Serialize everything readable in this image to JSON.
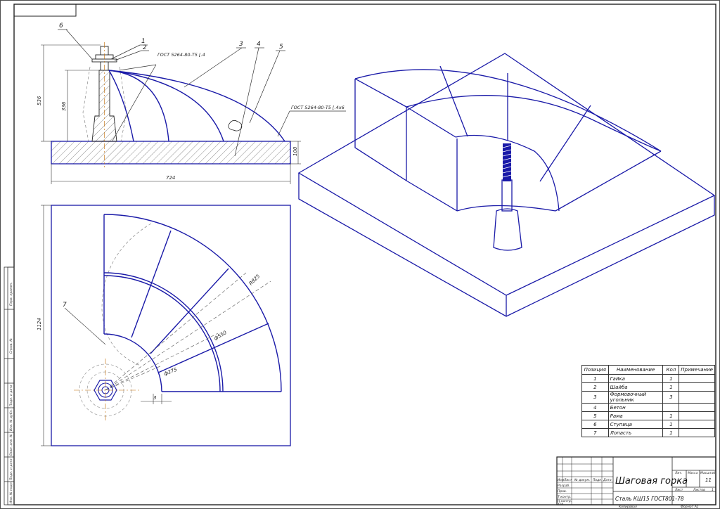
{
  "colors": {
    "line": "#1a1aa8",
    "thin": "#333333",
    "paper": "#ffffff"
  },
  "front_view": {
    "part_labels": [
      "1",
      "2",
      "3",
      "4",
      "5",
      "6"
    ],
    "weld_note_top": "ГОСТ 5264-80-Т5 ⌊.4",
    "weld_note_right": "ГОСТ 5264-80-Т5 ⌊.4х6",
    "dim_height_total": "536",
    "dim_height_hub": "336",
    "dim_base_thickness": "100",
    "dim_width": "724"
  },
  "top_view": {
    "part_label": "7",
    "dim_side": "1124",
    "dim_r825": "R825",
    "dim_r550": "ф550",
    "dim_r275": "ф275",
    "dim_gap": "3"
  },
  "spec_table": {
    "headers": [
      "Позиция",
      "Наименование",
      "Кол",
      "Примечание"
    ],
    "rows": [
      {
        "pos": "1",
        "name": "Гайка",
        "qty": "1",
        "note": ""
      },
      {
        "pos": "2",
        "name": "Шайба",
        "qty": "1",
        "note": ""
      },
      {
        "pos": "3",
        "name": "Формовочный угольник",
        "qty": "3",
        "note": ""
      },
      {
        "pos": "4",
        "name": "Бетон",
        "qty": "",
        "note": ""
      },
      {
        "pos": "5",
        "name": "Рама",
        "qty": "1",
        "note": ""
      },
      {
        "pos": "6",
        "name": "Ступица",
        "qty": "1",
        "note": ""
      },
      {
        "pos": "7",
        "name": "Лопасть",
        "qty": "1",
        "note": ""
      }
    ]
  },
  "title_block": {
    "title": "Шаговая горка",
    "material": "Сталь КШ15 ГОСТ801-78",
    "sheet_count": "11",
    "format": "Формат  А1",
    "copied": "Копировал",
    "col_izm": "Изм",
    "col_list": "Лист",
    "col_doc": "№ докум.",
    "col_sign": "Подп.",
    "col_date": "Дата",
    "row_razrab": "Разраб.",
    "row_prov": "Пров.",
    "row_tkontr": "Т.контр.",
    "row_nkontr": "Н.контр.",
    "row_utv": "Утв.",
    "lit": "Лит.",
    "mass": "Масса",
    "scale": "Масштаб",
    "list": "Лист",
    "listov": "Листов",
    "listov_val": "1"
  },
  "side_stamp": [
    "Перв. примен.",
    "Справ. №",
    "Подп. и дата",
    "Инв. № дубл.",
    "Взам. инв. №",
    "Подп. и дата",
    "Инв. № подл."
  ]
}
